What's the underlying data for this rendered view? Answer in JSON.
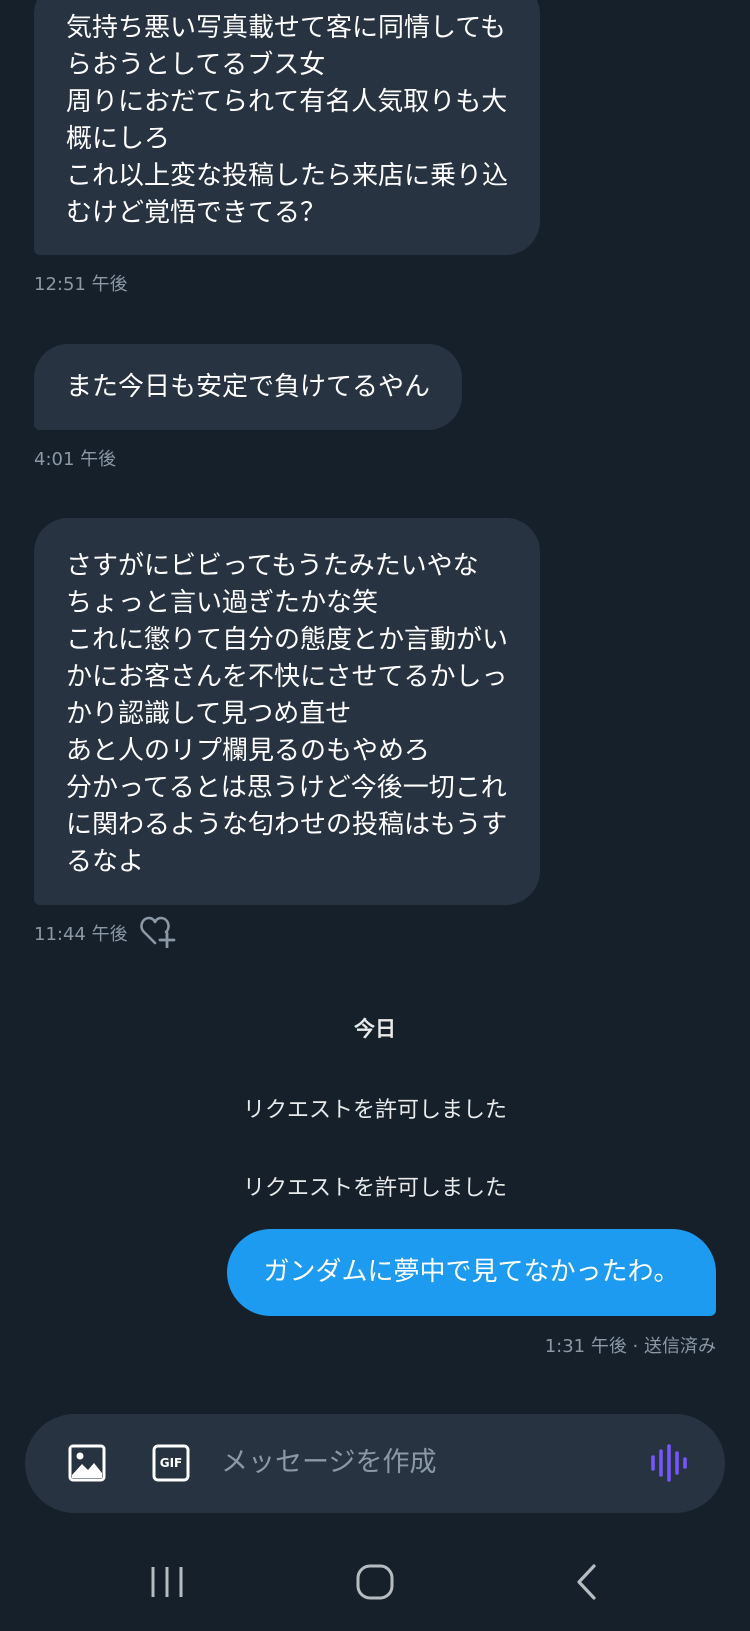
{
  "messages": [
    {
      "lines": [
        "気持ち悪い写真載せて客に同情しても",
        "らおうとしてるブス女",
        "周りにおだてられて有名人気取りも大",
        "概にしろ",
        "これ以上変な投稿したら来店に乗り込",
        "むけど覚悟できてる？"
      ],
      "time": "12:51 午後"
    },
    {
      "lines": [
        "また今日も安定で負けてるやん"
      ],
      "time": "4:01 午後"
    },
    {
      "lines": [
        "さすがにビビってもうたみたいやな",
        "ちょっと言い過ぎたかな笑",
        "これに懲りて自分の態度とか言動がい",
        "かにお客さんを不快にさせてるかしっ",
        "かり認識して見つめ直せ",
        "あと人のリプ欄見るのもやめろ",
        "分かってるとは思うけど今後一切これ",
        "に関わるような匂わせの投稿はもうす",
        "るなよ"
      ],
      "time": "11:44 午後"
    }
  ],
  "day_separator": "今日",
  "system_notices": [
    "リクエストを許可しました",
    "リクエストを許可しました"
  ],
  "outgoing": {
    "text": "ガンダムに夢中で見てなかったわ。",
    "status": "1:31 午後 · 送信済み"
  },
  "composer": {
    "placeholder": "メッセージを作成",
    "gif_label": "GIF"
  },
  "icons": {
    "image": "image-icon",
    "gif": "gif-icon",
    "voice": "voice-waveform-icon",
    "reaction": "add-reaction-heart-icon",
    "recents": "recents-icon",
    "home": "home-icon",
    "back": "back-icon"
  },
  "colors": {
    "background": "#15202b",
    "bubble_incoming": "#273340",
    "bubble_outgoing": "#1d9bf0",
    "voice_accent": "#7856ff",
    "muted_text": "#8b98a5"
  }
}
